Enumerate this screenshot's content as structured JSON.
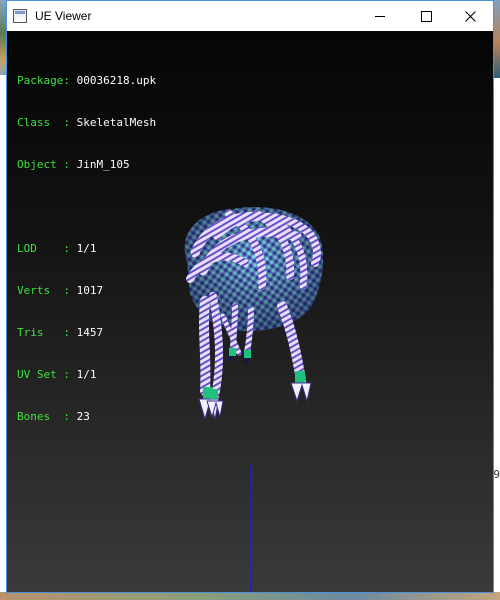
{
  "window": {
    "title": "UE Viewer"
  },
  "controls": {
    "minimize_icon": "minimize-icon",
    "maximize_icon": "maximize-icon",
    "close_icon": "close-icon"
  },
  "info": {
    "package_label": "Package:",
    "package_value": "00036218.upk",
    "class_label": "Class  :",
    "class_value": "SkeletalMesh",
    "object_label": "Object :",
    "object_value": "JinM_105",
    "lod_label": "LOD    :",
    "lod_value": "1/1",
    "verts_label": "Verts  :",
    "verts_value": "1017",
    "tris_label": "Tris   :",
    "tris_value": "1457",
    "uvset_label": "UV Set :",
    "uvset_value": "1/1",
    "bones_label": "Bones  :",
    "bones_value": "23"
  },
  "background": {
    "right_edge_glyph": "9"
  },
  "colors": {
    "label_green": "#3fe03f",
    "value_white": "#ffffff",
    "mesh_purple": "#6b5fd0",
    "mesh_cyan": "#6fd6d6",
    "foot_green": "#20c080",
    "axis_blue": "#1a1aff"
  }
}
